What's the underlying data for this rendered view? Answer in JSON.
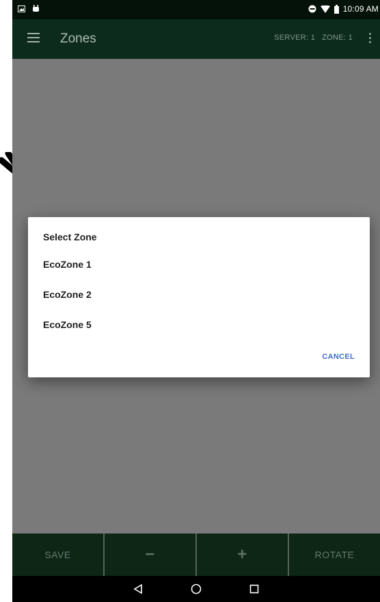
{
  "status_bar": {
    "time": "10:09 AM",
    "left_icons": [
      "image-icon",
      "android-icon"
    ],
    "right_icons": [
      "do-not-disturb-icon",
      "wifi-icon",
      "battery-icon"
    ]
  },
  "app_bar": {
    "title": "Zones",
    "server_label": "SERVER: 1",
    "zone_label": "ZONE: 1"
  },
  "dialog": {
    "title": "Select Zone",
    "items": [
      {
        "label": "EcoZone 1"
      },
      {
        "label": "EcoZone 2"
      },
      {
        "label": "EcoZone 5"
      }
    ],
    "cancel_label": "CANCEL"
  },
  "bottom_bar": {
    "save_label": "SAVE",
    "minus_label": "−",
    "plus_label": "+",
    "rotate_label": "ROTATE"
  },
  "nav_icons": [
    "back-icon",
    "home-icon",
    "recents-icon"
  ],
  "colors": {
    "app_bar": "#0d2b1c",
    "status_bar": "#041209",
    "bottom_bar": "#0d2616",
    "accent": "#3f6ec9",
    "scrim": "#7a7a7a"
  }
}
